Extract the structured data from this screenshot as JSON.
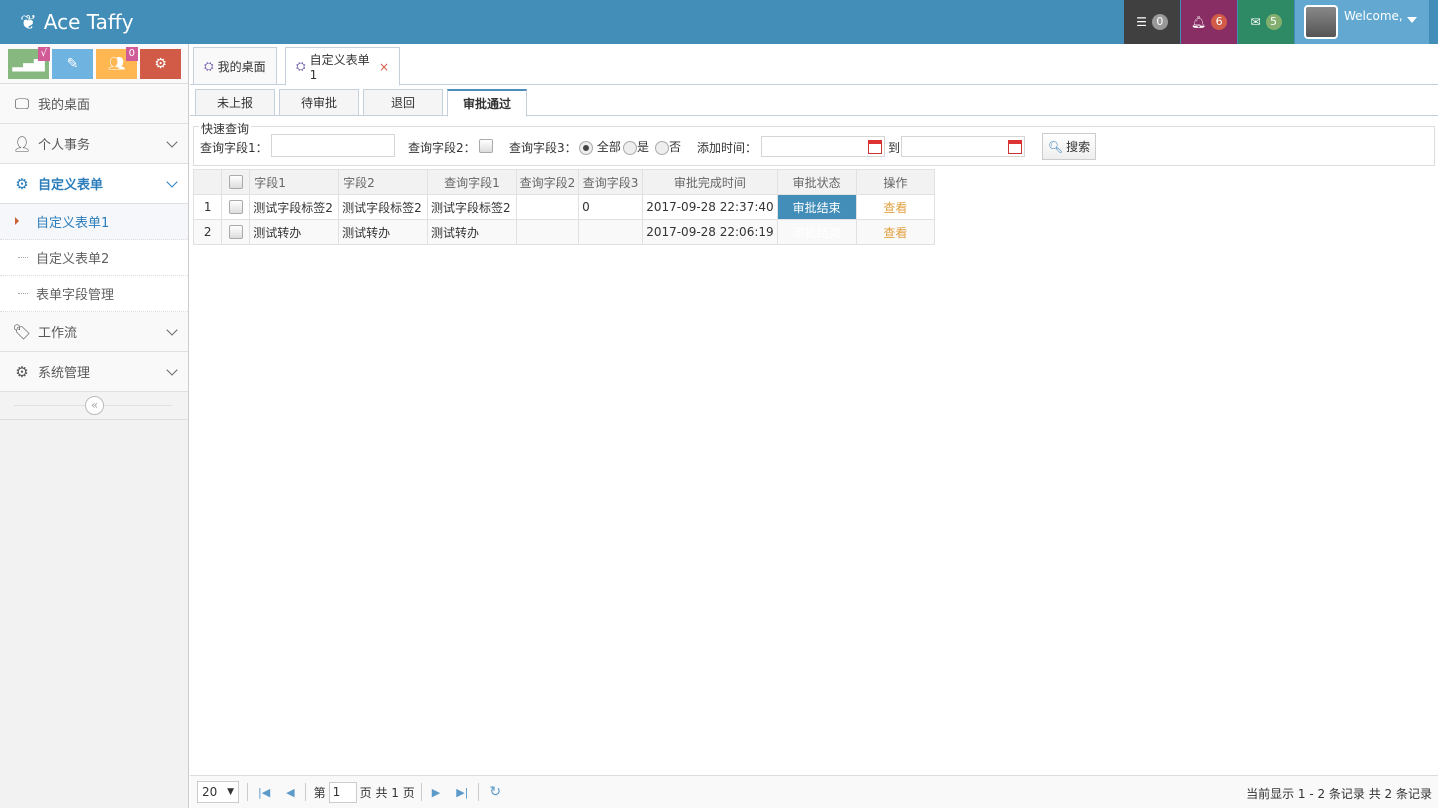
{
  "app": {
    "title": "Ace Taffy"
  },
  "topnav": {
    "tasks_count": "0",
    "notifications_count": "6",
    "messages_count": "5",
    "welcome": "Welcome,"
  },
  "shortcuts": {
    "badge1": "√",
    "badge3": "0"
  },
  "sidebar": {
    "items": [
      {
        "label": "我的桌面"
      },
      {
        "label": "个人事务"
      },
      {
        "label": "自定义表单"
      },
      {
        "label": "工作流"
      },
      {
        "label": "系统管理"
      }
    ],
    "sub_items": [
      {
        "label": "自定义表单1"
      },
      {
        "label": "自定义表单2"
      },
      {
        "label": "表单字段管理"
      }
    ],
    "collapse": "«"
  },
  "tabs": [
    {
      "label": "我的桌面"
    },
    {
      "label": "自定义表单1"
    }
  ],
  "tab_close": "×",
  "subtabs": [
    {
      "label": "未上报"
    },
    {
      "label": "待审批"
    },
    {
      "label": "退回"
    },
    {
      "label": "审批通过"
    }
  ],
  "search": {
    "legend": "快速查询",
    "field1_label": "查询字段1：",
    "field2_label": "查询字段2：",
    "field3_label": "查询字段3：",
    "opt_all": "全部",
    "opt_yes": "是",
    "opt_no": "否",
    "time_label": "添加时间：",
    "to": "到",
    "button": "搜索"
  },
  "grid": {
    "headers": [
      "字段1",
      "字段2",
      "查询字段1",
      "查询字段2",
      "查询字段3",
      "审批完成时间",
      "审批状态",
      "操作"
    ],
    "rows": [
      {
        "num": "1",
        "f1": "测试字段标签2",
        "f2": "测试字段标签2",
        "q1": "测试字段标签2",
        "q2": "",
        "q3": "0",
        "time": "2017-09-28 22:37:40",
        "status": "审批结束",
        "action": "查看"
      },
      {
        "num": "2",
        "f1": "测试转办",
        "f2": "测试转办",
        "q1": "测试转办",
        "q2": "",
        "q3": "",
        "time": "2017-09-28 22:06:19",
        "status": "审批结束",
        "action": "查看"
      }
    ]
  },
  "pager": {
    "page_size": "20",
    "page_prefix": "第",
    "page_value": "1",
    "page_suffix": "页 共 1 页",
    "info": "当前显示 1 - 2 条记录 共 2 条记录"
  },
  "colors": {
    "header": "#438eb9",
    "tasks": "#404040",
    "notifications": "#892e65",
    "messages": "#2e8965",
    "shortcut1": "#87b87f",
    "shortcut2": "#6fb3e0",
    "shortcut3": "#ffb752",
    "shortcut4": "#d15b47"
  }
}
